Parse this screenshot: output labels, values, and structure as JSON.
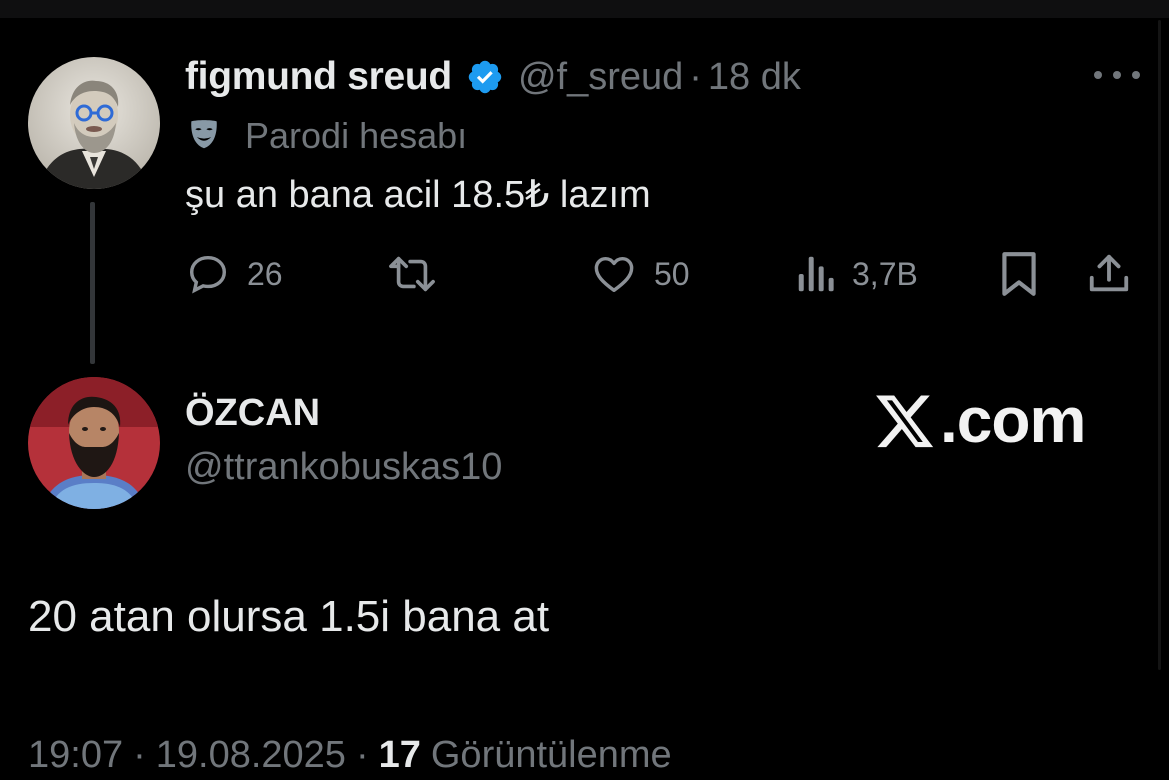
{
  "tweet": {
    "author": {
      "display_name": "figmund sreud",
      "handle": "@f_sreud",
      "verified": true,
      "avatar_icon": "avatar-old-man-round-glasses"
    },
    "time_separator": "·",
    "time_ago": "18 dk",
    "more_icon": "more-dots-icon",
    "parody_icon": "theater-mask-icon",
    "parody_label": "Parodi hesabı",
    "text": "şu an bana acil 18.5₺ lazım",
    "actions": {
      "reply_count": "26",
      "repost_count": "",
      "like_count": "50",
      "views_count": "3,7B"
    }
  },
  "reply": {
    "author": {
      "display_name": "ÖZCAN",
      "handle": "@ttrankobuskas10",
      "avatar_icon": "avatar-bearded-man"
    },
    "text": "20 atan olursa 1.5i bana at",
    "timestamp_time": "19:07",
    "separator": "·",
    "timestamp_date": "19.08.2025",
    "views_count": "17",
    "views_label": "Görüntülenme"
  },
  "watermark": {
    "text": ".com",
    "logo_icon": "x-logo-icon"
  },
  "colors": {
    "background": "#000000",
    "primary_text": "#e7e9ea",
    "secondary_text": "#71767b",
    "verified_blue": "#1d9bf0",
    "thread_line": "#333639"
  }
}
